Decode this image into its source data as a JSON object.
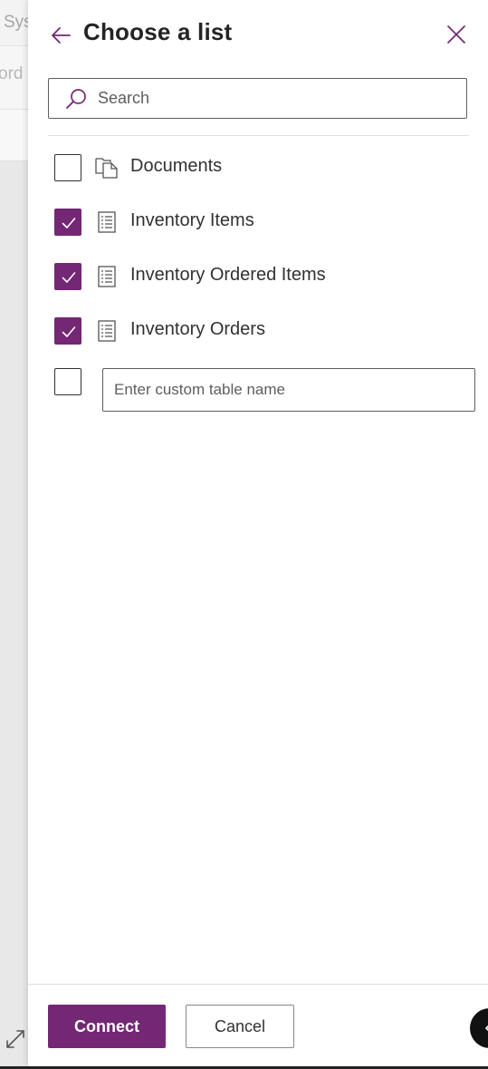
{
  "background": {
    "partial_text_1": "Sys",
    "partial_text_2": "ord"
  },
  "panel": {
    "title": "Choose a list",
    "back_icon": "arrow-left-icon",
    "close_icon": "close-icon"
  },
  "search": {
    "placeholder": "Search",
    "value": "",
    "icon": "search-icon"
  },
  "lists": [
    {
      "label": "Documents",
      "checked": false,
      "icon": "document-library-icon"
    },
    {
      "label": "Inventory Items",
      "checked": true,
      "icon": "list-icon"
    },
    {
      "label": "Inventory Ordered Items",
      "checked": true,
      "icon": "list-icon"
    },
    {
      "label": "Inventory Orders",
      "checked": true,
      "icon": "list-icon"
    }
  ],
  "custom_table": {
    "checked": false,
    "placeholder": "Enter custom table name",
    "value": ""
  },
  "footer": {
    "connect_label": "Connect",
    "cancel_label": "Cancel"
  },
  "colors": {
    "accent": "#742774",
    "text": "#323130",
    "border": "#605e5c"
  }
}
